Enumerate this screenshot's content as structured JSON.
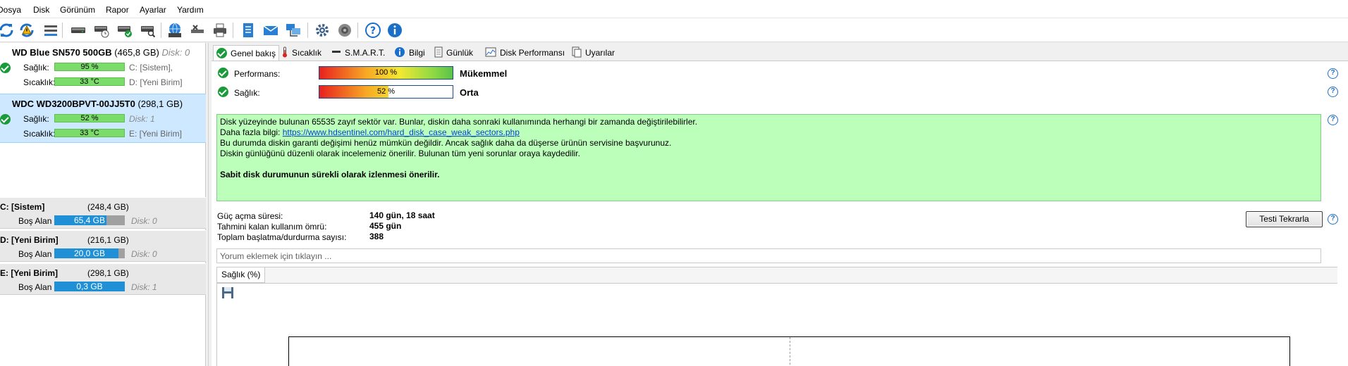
{
  "menu": [
    "Dosya",
    "Disk",
    "Görünüm",
    "Rapor",
    "Ayarlar",
    "Yardım"
  ],
  "toolbar": {
    "icons": [
      "refresh-icon",
      "refresh-warning-icon",
      "disk-list-icon",
      "disk-icon",
      "disk-clock-icon",
      "disk-check-icon",
      "disk-search-icon",
      "globe-disk-icon",
      "tools-icon",
      "printer-icon",
      "notes-icon",
      "mail-icon",
      "network-icon",
      "gear-icon",
      "speaker-icon",
      "help-icon",
      "info-icon"
    ]
  },
  "disks": [
    {
      "name": "WD Blue SN570 500GB",
      "size": "(465,8 GB)",
      "disk_num": "Disk: 0",
      "health_label": "Sağlık:",
      "health": "95 %",
      "health_value": 95,
      "temp_label": "Sıcaklık:",
      "temp": "33 °C",
      "parts": [
        "C: [Sistem],",
        "D: [Yeni Birim]"
      ],
      "selected": false
    },
    {
      "name": "WDC WD3200BPVT-00JJ5T0",
      "size": "(298,1 GB)",
      "disk_num": "Disk: 1",
      "health_label": "Sağlık:",
      "health": "52 %",
      "health_value": 52,
      "temp_label": "Sıcaklık:",
      "temp": "33 °C",
      "parts": [
        "Disk: 1",
        "E: [Yeni Birim]"
      ],
      "selected": true
    }
  ],
  "volumes": [
    {
      "name": "C: [Sistem]",
      "size": "(248,4 GB)",
      "free_label": "Boş Alan",
      "free": "65,4 GB",
      "used_pct": 74,
      "disk": "Disk: 0"
    },
    {
      "name": "D: [Yeni Birim]",
      "size": "(216,1 GB)",
      "free_label": "Boş Alan",
      "free": "20,0 GB",
      "used_pct": 91,
      "disk": "Disk: 0"
    },
    {
      "name": "E: [Yeni Birim]",
      "size": "(298,1 GB)",
      "free_label": "Boş Alan",
      "free": "0,3 GB",
      "used_pct": 100,
      "disk": "Disk: 1"
    }
  ],
  "tabs": [
    {
      "label": "Genel bakış",
      "icon": "check-icon"
    },
    {
      "label": "Sıcaklık",
      "icon": "thermometer-icon"
    },
    {
      "label": "S.M.A.R.T.",
      "icon": "smart-icon"
    },
    {
      "label": "Bilgi",
      "icon": "info-icon"
    },
    {
      "label": "Günlük",
      "icon": "log-icon"
    },
    {
      "label": "Disk Performansı",
      "icon": "performance-icon"
    },
    {
      "label": "Uyarılar",
      "icon": "alerts-icon"
    }
  ],
  "overview": {
    "performance_label": "Performans:",
    "performance": "100 %",
    "performance_value": 100,
    "performance_rating": "Mükemmel",
    "health_label": "Sağlık:",
    "health": "52 %",
    "health_value": 52,
    "health_rating": "Orta",
    "message": {
      "line1": "Disk yüzeyinde bulunan 65535 zayıf sektör var. Bunlar, diskin daha sonraki kullanımında herhangi bir zamanda değiştirilebilirler.",
      "line2_prefix": "Daha fazla bilgi: ",
      "link": "https://www.hdsentinel.com/hard_disk_case_weak_sectors.php",
      "line3": "Bu durumda diskin garanti değişimi henüz mümkün değildir. Ancak sağlık daha da düşerse ürünün servisine başvurunuz.",
      "line4": "Diskin günlüğünü düzenli olarak incelemeniz önerilir. Bulunan tüm yeni sorunlar oraya kaydedilir.",
      "line5": "Sabit disk durumunun sürekli olarak izlenmesi önerilir."
    },
    "power_on_label": "Güç açma süresi:",
    "power_on": "140 gün, 18 saat",
    "lifetime_label": "Tahmini kalan kullanım ömrü:",
    "lifetime": "455 gün",
    "start_stop_label": "Toplam başlatma/durdurma sayısı:",
    "start_stop": "388",
    "repeat_button": "Testi Tekrarla",
    "comment_placeholder": "Yorum eklemek için tıklayın ...",
    "chart_tab": "Sağlık (%)"
  },
  "colors": {
    "health_bar": "#7bdc6c",
    "free_space": "#1f90d6",
    "message_bg": "#bbffbb",
    "selection": "#cde8ff"
  }
}
